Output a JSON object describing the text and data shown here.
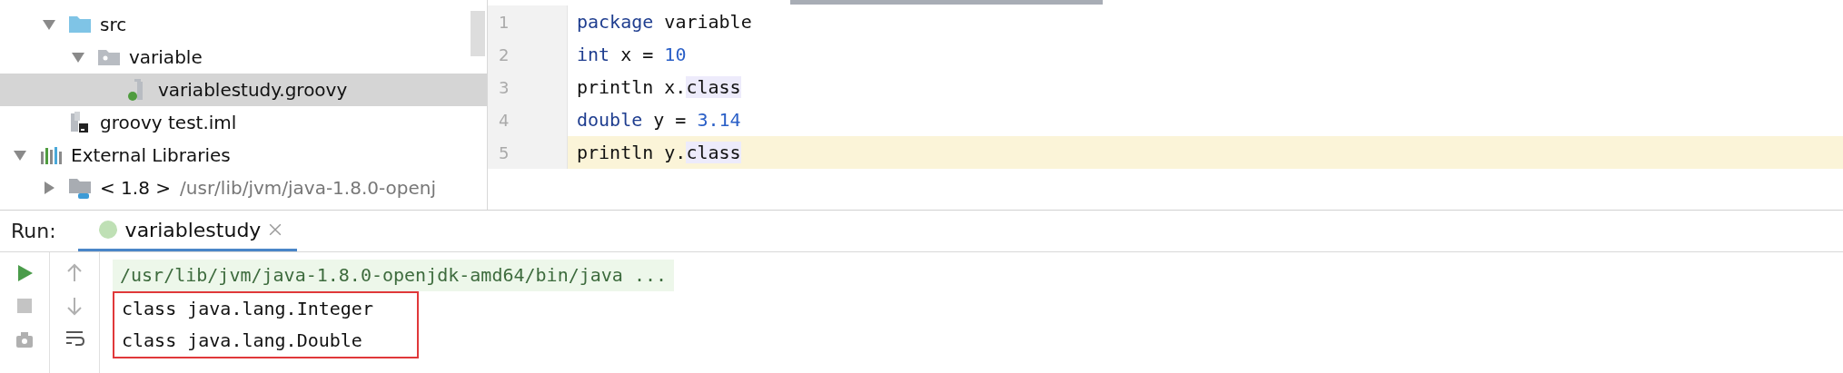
{
  "project_tree": {
    "project_children": [
      {
        "label": "src",
        "kind": "source-folder",
        "expanded": true,
        "selected": false,
        "children": [
          {
            "label": "variable",
            "kind": "package",
            "expanded": true,
            "selected": false,
            "children": [
              {
                "label": "variablestudy.groovy",
                "kind": "groovy-file",
                "selected": true
              }
            ]
          }
        ]
      },
      {
        "label": "groovy test.iml",
        "kind": "module-file",
        "selected": false
      }
    ],
    "libraries": {
      "label": "External Libraries",
      "kind": "libraries",
      "expanded": true,
      "selected": false,
      "children": [
        {
          "label": "< 1.8 >",
          "detail": "/usr/lib/jvm/java-1.8.0-openj",
          "kind": "jdk",
          "expanded": false,
          "selected": false
        }
      ]
    }
  },
  "editor": {
    "lines": [
      {
        "number": "1",
        "current": false,
        "tokens": [
          {
            "text": "package",
            "kind": "keyword"
          },
          {
            "text": " variable",
            "kind": "plain"
          }
        ]
      },
      {
        "number": "2",
        "current": false,
        "tokens": [
          {
            "text": "int",
            "kind": "keyword"
          },
          {
            "text": " x = ",
            "kind": "plain"
          },
          {
            "text": "10",
            "kind": "number"
          }
        ]
      },
      {
        "number": "3",
        "current": false,
        "tokens": [
          {
            "text": "println x.",
            "kind": "plain"
          },
          {
            "text": "class",
            "kind": "highlight"
          }
        ]
      },
      {
        "number": "4",
        "current": false,
        "tokens": [
          {
            "text": "double",
            "kind": "keyword"
          },
          {
            "text": " y = ",
            "kind": "plain"
          },
          {
            "text": "3.14",
            "kind": "number"
          }
        ]
      },
      {
        "number": "5",
        "current": true,
        "tokens": [
          {
            "text": "println y.",
            "kind": "plain"
          },
          {
            "text": "class",
            "kind": "highlight"
          }
        ]
      }
    ]
  },
  "run_panel": {
    "label": "Run:",
    "tabs": [
      {
        "label": "variablestudy",
        "selected": true
      }
    ],
    "output": [
      {
        "text": "/usr/lib/jvm/java-1.8.0-openjdk-amd64/bin/java ...",
        "kind": "command",
        "boxed": false
      },
      {
        "text": "class java.lang.Integer",
        "kind": "stdout",
        "boxed": true
      },
      {
        "text": "class java.lang.Double",
        "kind": "stdout",
        "boxed": true
      }
    ]
  }
}
